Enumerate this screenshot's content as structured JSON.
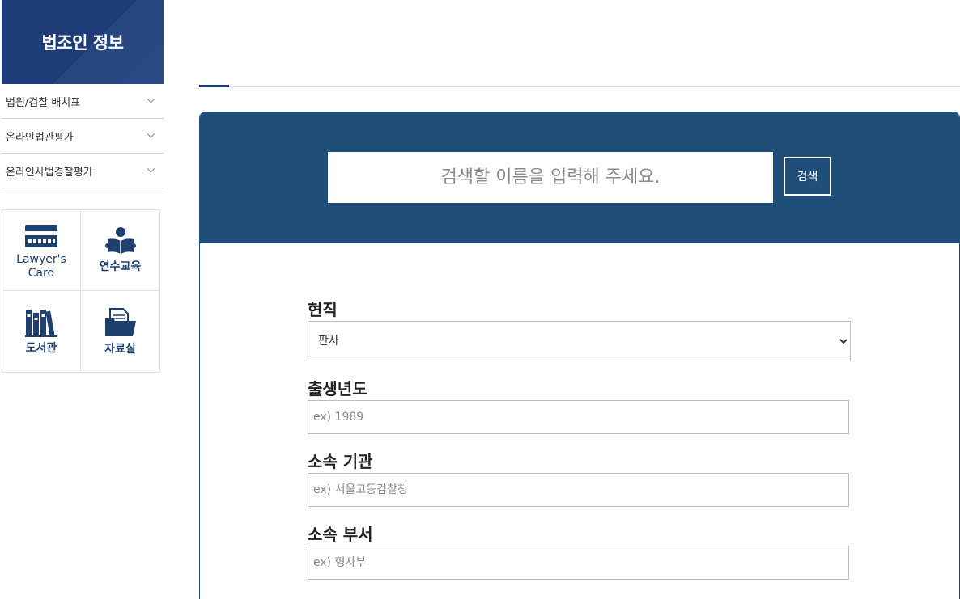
{
  "sidebar": {
    "title": "법조인 정보",
    "menu": [
      {
        "label": "법원/검찰 배치표"
      },
      {
        "label": "온라인법관평가"
      },
      {
        "label": "온라인사법경찰평가"
      }
    ],
    "quick_links": [
      {
        "label": "Lawyer's Card",
        "icon": "card-icon"
      },
      {
        "label": "연수교육",
        "icon": "reading-person-icon"
      },
      {
        "label": "도서관",
        "icon": "books-icon"
      },
      {
        "label": "자료실",
        "icon": "folder-document-icon"
      }
    ]
  },
  "search": {
    "placeholder": "검색할 이름을 입력해 주세요.",
    "button_label": "검색"
  },
  "form": {
    "position": {
      "label": "현직",
      "selected": "판사"
    },
    "birth_year": {
      "label": "출생년도",
      "placeholder": "ex) 1989"
    },
    "organization": {
      "label": "소속 기관",
      "placeholder": "ex) 서울고등검찰청"
    },
    "department": {
      "label": "소속 부서",
      "placeholder": "ex) 형사부"
    }
  },
  "colors": {
    "brand_navy": "#1e3c78",
    "panel_blue": "#1f4e79",
    "icon_navy": "#1f3f6e"
  }
}
